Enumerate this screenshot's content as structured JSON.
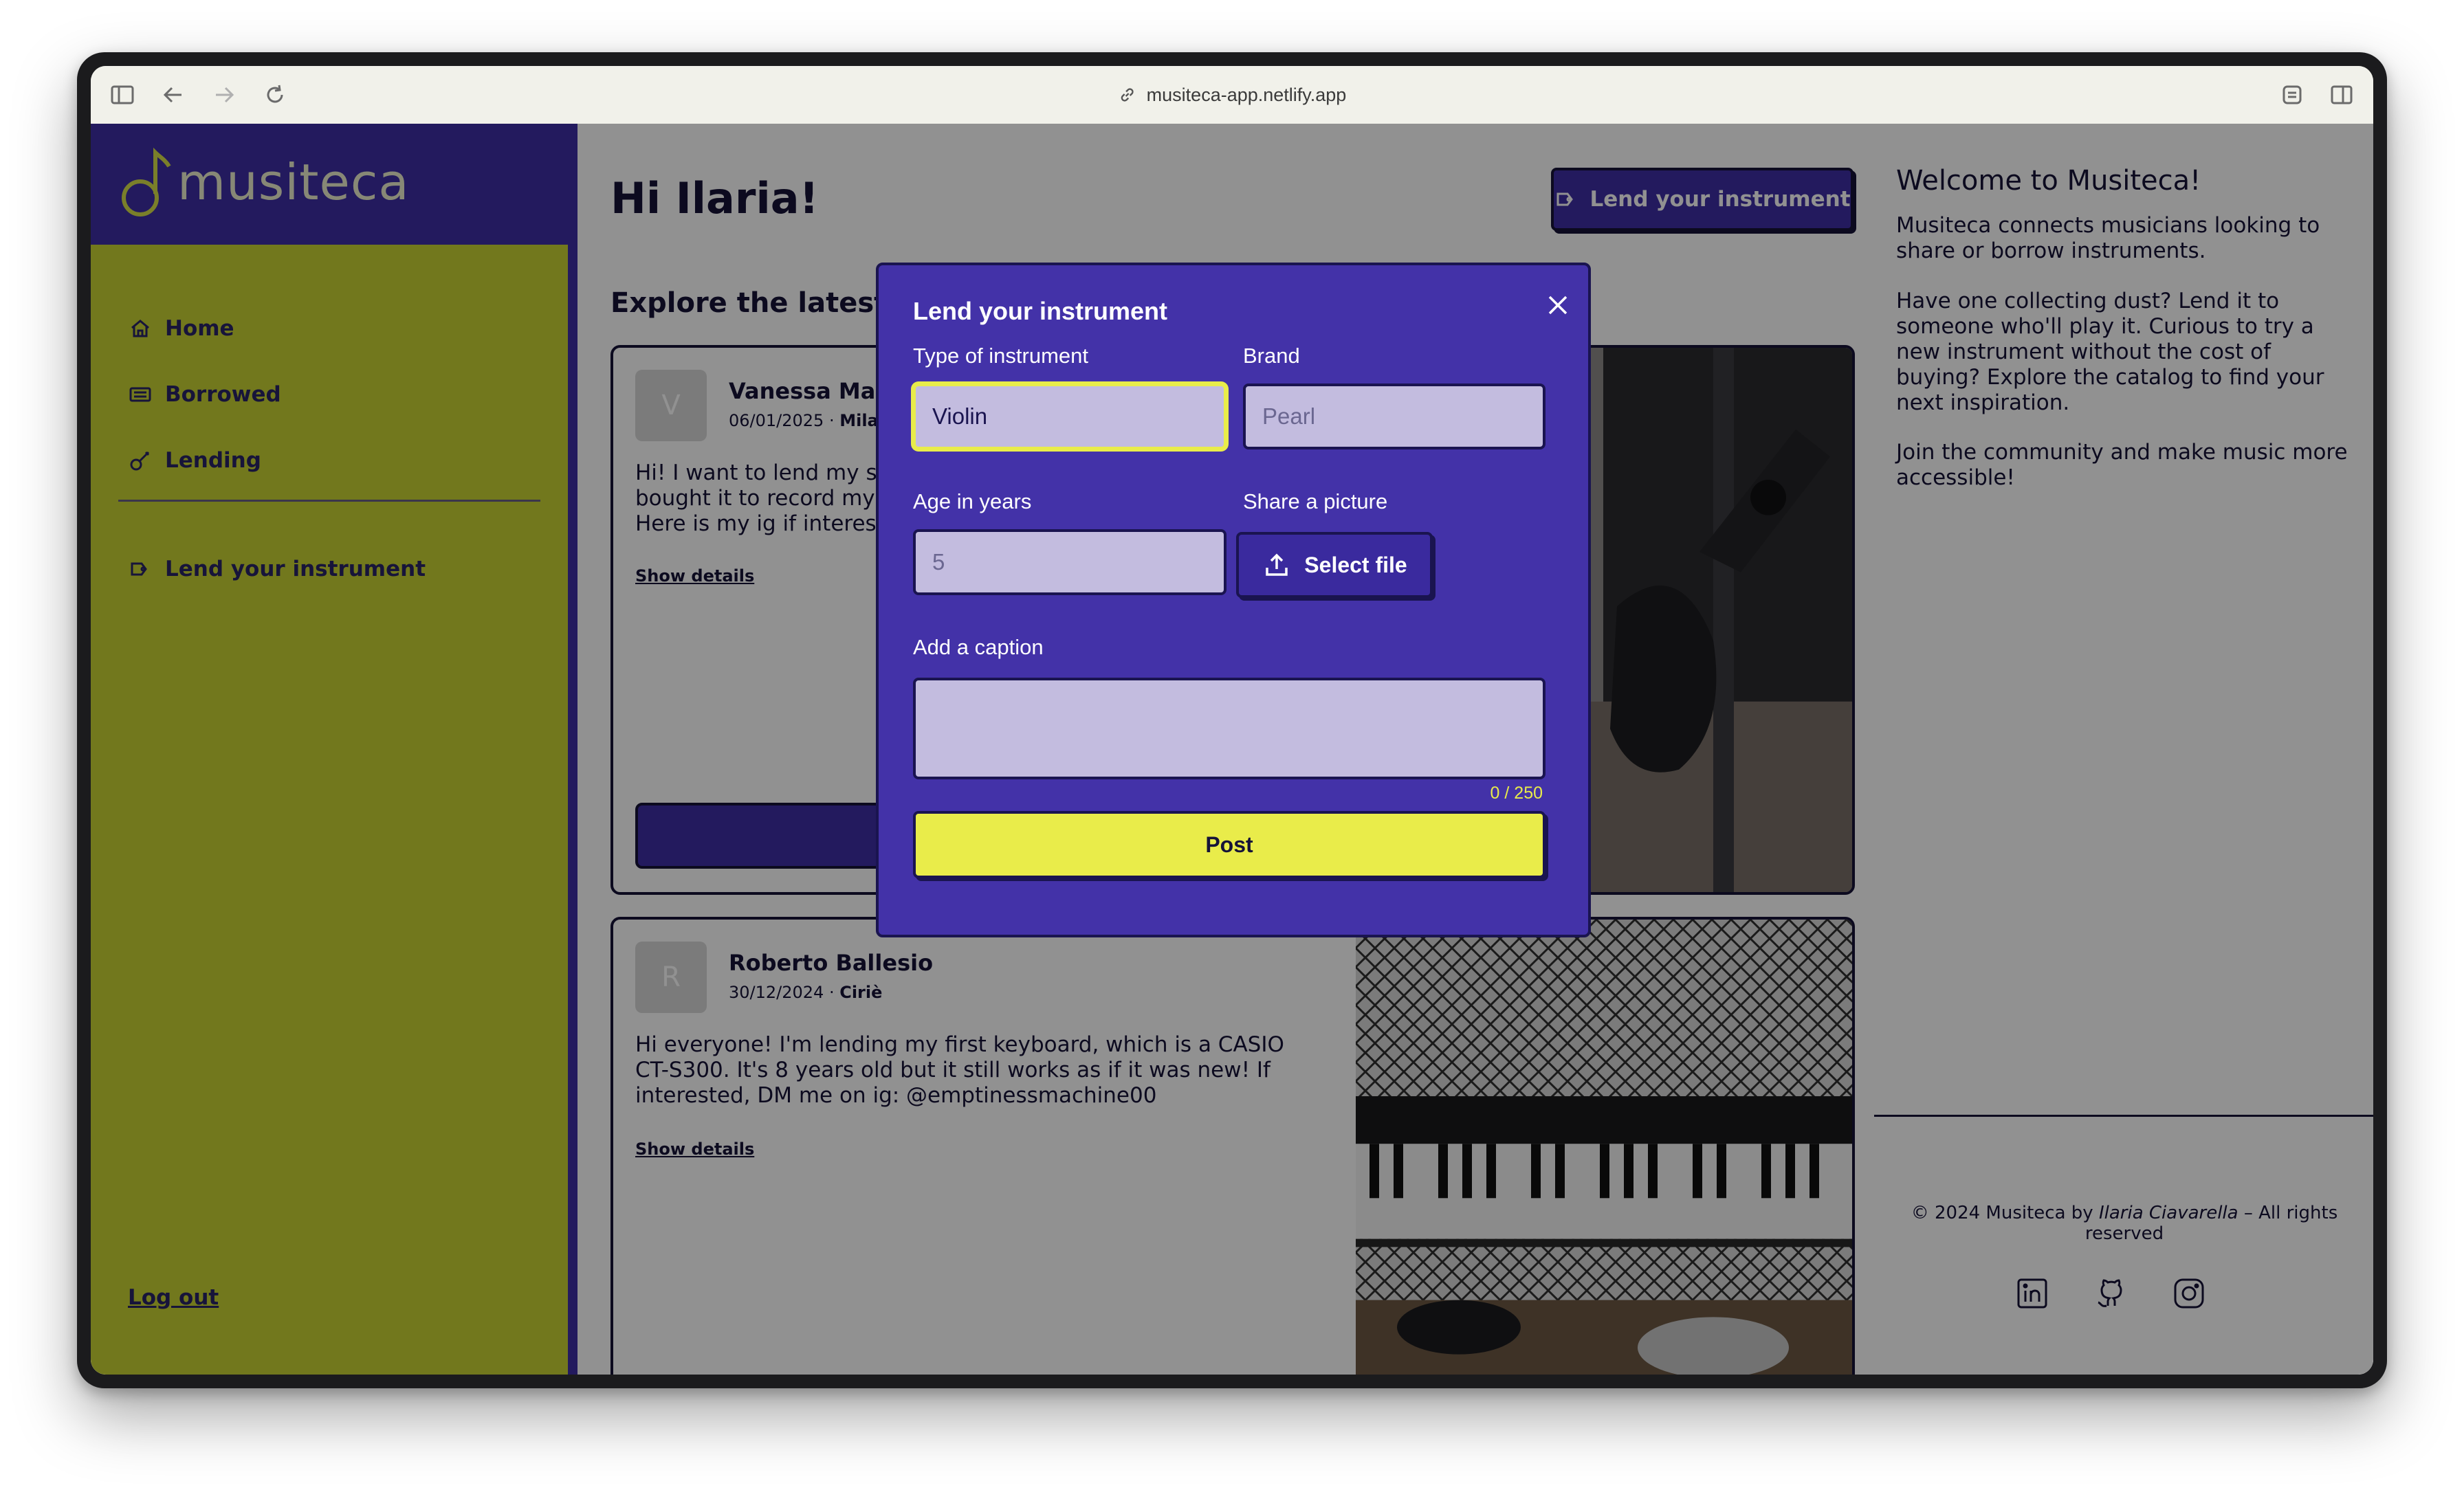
{
  "browser": {
    "url": "musiteca-app.netlify.app"
  },
  "brand": {
    "name": "musiteca"
  },
  "sidebar": {
    "items": [
      {
        "label": "Home",
        "icon": "home-icon"
      },
      {
        "label": "Borrowed",
        "icon": "borrowed-icon"
      },
      {
        "label": "Lending",
        "icon": "guitar-icon"
      }
    ],
    "lend_label": "Lend your instrument",
    "logout_label": "Log out"
  },
  "main": {
    "greeting": "Hi Ilaria!",
    "lend_button": "Lend your instrument",
    "explore_title": "Explore the latest posts",
    "posts": [
      {
        "initial": "V",
        "author": "Vanessa Marcellino",
        "date": "06/01/2025",
        "city": "Milano",
        "text": "Hi! I want to lend my studio microphone because I don't use it. I bought it to record my vocals but that was not a good idea. Here is my ig if interested",
        "show_details": "Show details"
      },
      {
        "initial": "R",
        "author": "Roberto Ballesio",
        "date": "30/12/2024",
        "city": "Ciriè",
        "text": "Hi everyone! I'm lending my first keyboard, which is a CASIO CT-S300. It's 8 years old but it still works as if it was new! If interested, DM me on ig: @emptinessmachine00",
        "show_details": "Show details"
      }
    ]
  },
  "rightcol": {
    "title": "Welcome to Musiteca!",
    "paragraphs": [
      "Musiteca connects musicians looking to share or borrow instruments.",
      "Have one collecting dust? Lend it to someone who'll play it. Curious to try a new instrument without the cost of buying? Explore the catalog to find your next inspiration.",
      "Join the community and make music more accessible!"
    ],
    "copyright_prefix": "© 2024 Musiteca by ",
    "copyright_name": "Ilaria Ciavarella",
    "copyright_suffix": " – All rights reserved",
    "socials": [
      "linkedin-icon",
      "github-icon",
      "instagram-icon"
    ]
  },
  "modal": {
    "title": "Lend your instrument",
    "type_label": "Type of instrument",
    "type_value": "Violin",
    "brand_label": "Brand",
    "brand_placeholder": "Pearl",
    "age_label": "Age in years",
    "age_placeholder": "5",
    "picture_label": "Share a picture",
    "select_file": "Select file",
    "caption_label": "Add a caption",
    "caption_counter": "0 / 250",
    "post_button": "Post"
  },
  "colors": {
    "primary": "#3f2ea6",
    "accent": "#c9d334",
    "highlight": "#e9ec4a",
    "dark": "#161338"
  }
}
